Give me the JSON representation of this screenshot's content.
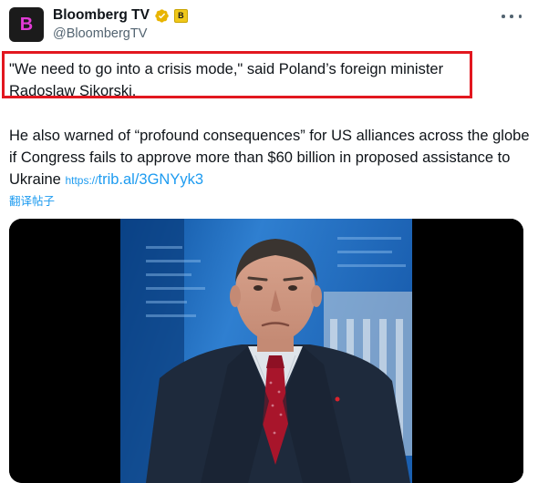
{
  "tweet": {
    "display_name": "Bloomberg TV",
    "handle": "@BloombergTV",
    "avatar_letter": "B",
    "affiliation_letter": "B",
    "quote": "\"We need to go into a crisis mode,\" said Poland’s foreign minister Radoslaw Sikorski.",
    "body": "He also warned of “profound consequences” for US alliances across the globe if Congress fails to approve more than $60 billion in proposed assistance to Ukraine",
    "link_protocol": "https://",
    "link_rest": "trib.al/3GNYyk3",
    "translate_label": "翻译帖子"
  },
  "colors": {
    "avatar_bg": "#1b1b1b",
    "avatar_letter": "#e23bd6",
    "verified_badge": "#e8b400",
    "highlight_box": "#e2171f",
    "link": "#1d9bf0"
  },
  "icons": [
    "verified-badge-icon",
    "affiliation-badge-icon",
    "more-options-icon"
  ]
}
